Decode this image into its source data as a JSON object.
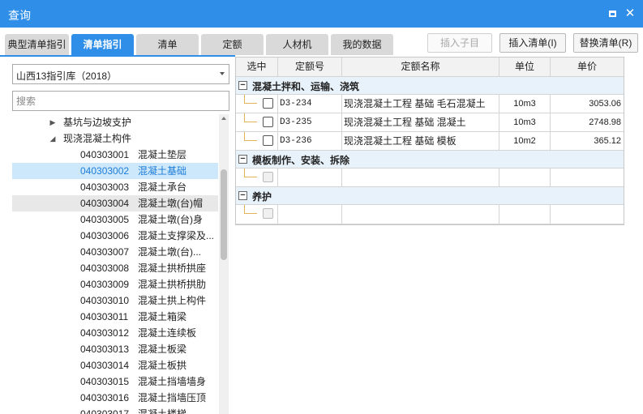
{
  "window": {
    "title": "查询",
    "maximize_icon": "maximize-icon",
    "close_icon": "close-icon"
  },
  "tabs": [
    "典型清单指引",
    "清单指引",
    "清单",
    "定额",
    "人材机",
    "我的数据"
  ],
  "buttons": {
    "insert_child": "插入子目",
    "insert_list": "插入清单(I)",
    "replace_list": "替换清单(R)"
  },
  "left": {
    "library": "山西13指引库（2018）",
    "search_placeholder": "搜索",
    "tree": [
      {
        "kind": "folder",
        "text": "基坑与边坡支护"
      },
      {
        "kind": "folder",
        "text": "现浇混凝土构件"
      },
      {
        "code": "040303001",
        "name": "混凝土垫层"
      },
      {
        "code": "040303002",
        "name": "混凝土基础"
      },
      {
        "code": "040303003",
        "name": "混凝土承台"
      },
      {
        "code": "040303004",
        "name": "混凝土墩(台)帽"
      },
      {
        "code": "040303005",
        "name": "混凝土墩(台)身"
      },
      {
        "code": "040303006",
        "name": "混凝土支撑梁及..."
      },
      {
        "code": "040303007",
        "name": "混凝土墩(台)..."
      },
      {
        "code": "040303008",
        "name": "混凝土拱桥拱座"
      },
      {
        "code": "040303009",
        "name": "混凝土拱桥拱肋"
      },
      {
        "code": "040303010",
        "name": "混凝土拱上构件"
      },
      {
        "code": "040303011",
        "name": "混凝土箱梁"
      },
      {
        "code": "040303012",
        "name": "混凝土连续板"
      },
      {
        "code": "040303013",
        "name": "混凝土板梁"
      },
      {
        "code": "040303014",
        "name": "混凝土板拱"
      },
      {
        "code": "040303015",
        "name": "混凝土挡墙墙身"
      },
      {
        "code": "040303016",
        "name": "混凝土挡墙压顶"
      },
      {
        "code": "040303017",
        "name": "混凝土楼梯"
      }
    ]
  },
  "grid": {
    "headers": [
      "选中",
      "定额号",
      "定额名称",
      "单位",
      "单价"
    ],
    "groups": [
      {
        "title": "混凝土拌和、运输、浇筑",
        "rows": [
          {
            "code": "D3-234",
            "name": "现浇混凝土工程 基础 毛石混凝土",
            "unit": "10m3",
            "price": "3053.06"
          },
          {
            "code": "D3-235",
            "name": "现浇混凝土工程 基础 混凝土",
            "unit": "10m3",
            "price": "2748.98"
          },
          {
            "code": "D3-236",
            "name": "现浇混凝土工程 基础 模板",
            "unit": "10m2",
            "price": "365.12"
          }
        ]
      },
      {
        "title": "模板制作、安装、拆除",
        "rows": []
      },
      {
        "title": "养护",
        "rows": []
      }
    ]
  },
  "colors": {
    "accent": "#2f8fe8",
    "selected_row_bg": "#cde8fb",
    "group_row_bg": "#e8f2fb"
  }
}
